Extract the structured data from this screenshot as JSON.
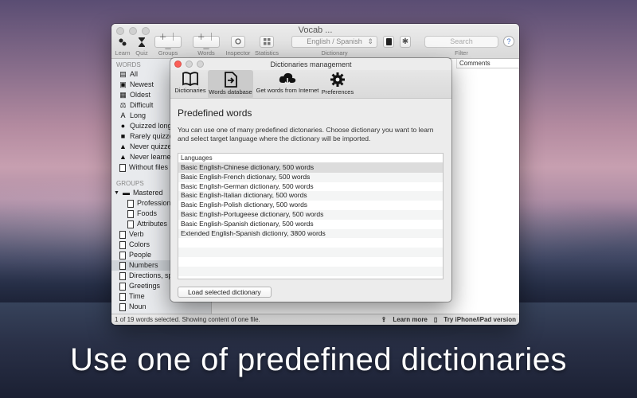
{
  "window": {
    "title": "Vocab ...",
    "toolbar": [
      {
        "label": "Learn",
        "icon": "learn-icon"
      },
      {
        "label": "Quiz",
        "icon": "hourglass-icon"
      },
      {
        "label": "Groups",
        "icon": "plus-minus-icon"
      },
      {
        "label": "Words",
        "icon": "plus-minus-icon"
      },
      {
        "label": "Inspector",
        "icon": "inspector-icon"
      },
      {
        "label": "Statistics",
        "icon": "grid-icon"
      }
    ],
    "language": {
      "value": "English / Spanish",
      "label": "Dictionary"
    },
    "search": {
      "placeholder": "Search",
      "label": "Filter"
    },
    "column_header": "Comments"
  },
  "sidebar": {
    "words_header": "WORDS",
    "words": [
      "All",
      "Newest",
      "Oldest",
      "Difficult",
      "Long",
      "Quizzed long",
      "Rarely quizze",
      "Never quizze",
      "Never learned",
      "Without files"
    ],
    "groups_header": "GROUPS",
    "groups": [
      {
        "label": "Mastered",
        "level": 0,
        "folder": true
      },
      {
        "label": "Professions",
        "level": 1
      },
      {
        "label": "Foods",
        "level": 1
      },
      {
        "label": "Attributes",
        "level": 1
      },
      {
        "label": "Verb",
        "level": 0
      },
      {
        "label": "Colors",
        "level": 0
      },
      {
        "label": "People",
        "level": 0
      },
      {
        "label": "Numbers",
        "level": 0,
        "selected": true
      },
      {
        "label": "Directions, sp",
        "level": 0
      },
      {
        "label": "Greetings",
        "level": 0
      },
      {
        "label": "Time",
        "level": 0
      },
      {
        "label": "Noun",
        "level": 0
      }
    ]
  },
  "status": {
    "text": "1 of 19 words selected. Showing content of one file.",
    "learn_more": "Learn more",
    "try_ios": "Try iPhone/iPad version"
  },
  "dialog": {
    "title": "Dictionaries management",
    "tabs": [
      {
        "label": "Dictionaries",
        "icon": "book-icon"
      },
      {
        "label": "Words database",
        "icon": "import-document-icon",
        "selected": true
      },
      {
        "label": "Get words from Internet",
        "icon": "cloud-download-icon"
      },
      {
        "label": "Preferences",
        "icon": "gear-icon"
      }
    ],
    "heading": "Predefined words",
    "description": "You can use one of many predefined dictonaries. Choose dictionary you want to learn and select target language where the dictionary will be imported.",
    "list_header": "Languages",
    "dictionaries": [
      "Basic English-Chinese dictionary, 500 words",
      "Basic English-French dictionary, 500 words",
      "Basic English-German dictionary, 500 words",
      "Basic English-Italian dictionary, 500 words",
      "Basic English-Polish dictionary, 500 words",
      "Basic English-Portugeese dictionary, 500 words",
      "Basic English-Spanish dictionary, 500 words",
      "Extended English-Spanish dictionry, 3800 words"
    ],
    "load_button": "Load selected dictionary"
  },
  "caption": "Use one of predefined dictionaries",
  "colors": {
    "close": "#fc5f57",
    "minimize": "#d5d5d5",
    "zoom": "#d5d5d5"
  }
}
